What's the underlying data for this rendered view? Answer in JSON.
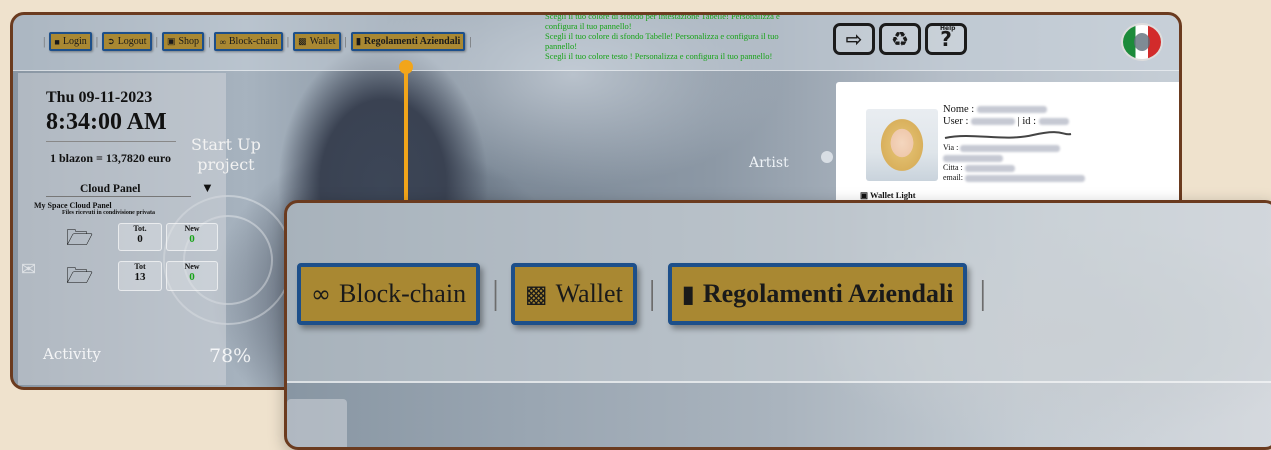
{
  "nav": {
    "items": [
      {
        "label": "Login",
        "icon": "user-icon",
        "bold": false
      },
      {
        "label": "Logout",
        "icon": "logout-icon",
        "bold": false
      },
      {
        "label": "Shop",
        "icon": "shop-icon",
        "bold": false
      },
      {
        "label": "Block-chain",
        "icon": "link-icon",
        "bold": false
      },
      {
        "label": "Wallet",
        "icon": "credit-card-icon",
        "bold": false
      },
      {
        "label": "Regolamenti Aziendali",
        "icon": "book-icon",
        "bold": true
      }
    ]
  },
  "notice": {
    "line1": "Scegli il tuo colore di sfondo per intestazione Tabelle! Personalizza e configura il tuo pannello!",
    "line2": "Scegli il tuo colore di sfondo Tabelle! Personalizza e configura il tuo pannello!",
    "line3": "Scegli il tuo colore testo ! Personalizza e configura il tuo pannello!"
  },
  "tools": {
    "help_label": "Help",
    "icons": [
      "login-panel-icon",
      "recycle-icon",
      "help-icon"
    ]
  },
  "flag": {
    "icon": "italy-flag-icon",
    "colors": [
      "#1c8b3a",
      "#ffffff",
      "#d22b2b"
    ]
  },
  "clock": {
    "date": "Thu 09-11-2023",
    "time": "8:34:00 AM",
    "rate": "1 blazon = 13,7820 euro"
  },
  "cloud": {
    "title": "Cloud Panel",
    "subtitle": "My Space Cloud Panel",
    "files_label": "Files ricevuti in condivisione privata",
    "row1": {
      "tot_label": "Tot.",
      "tot": "0",
      "new_label": "New",
      "new": "0"
    },
    "row2": {
      "tot_label": "Tot",
      "tot": "13",
      "new_label": "New",
      "new": "0"
    }
  },
  "background": {
    "startup_line1": "Start Up",
    "startup_line2": "project",
    "artist": "Artist",
    "activity": "Activity",
    "percent": "78%"
  },
  "user": {
    "name_label": "Nome :",
    "user_label": "User :",
    "id_label": "| id :",
    "via_label": "Via :",
    "citta_label": "Citta :",
    "email_label": "email:",
    "wallet_light": "Wallet Light"
  },
  "zoom": {
    "items": [
      {
        "label": "Block-chain",
        "icon": "link-icon",
        "bold": false
      },
      {
        "label": "Wallet",
        "icon": "credit-card-icon",
        "bold": false
      },
      {
        "label": "Regolamenti Aziendali",
        "icon": "book-icon",
        "bold": true
      }
    ]
  },
  "colors": {
    "button_bg": "#a98832",
    "button_border": "#1d4f8a",
    "frame": "#6b3b1f",
    "accent_pin": "#f2a51a",
    "notice_text": "#17a317"
  }
}
